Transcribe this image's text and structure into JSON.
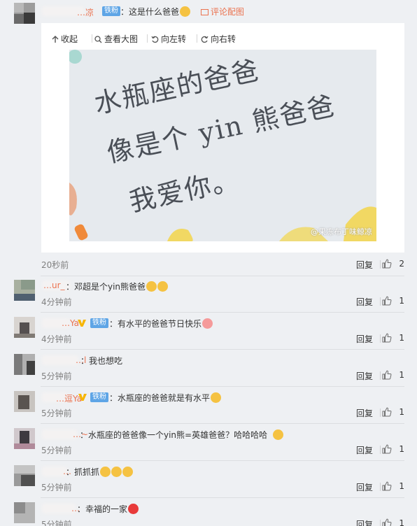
{
  "top_comment": {
    "name": "…凉",
    "fans_badge": "铁粉",
    "text": "：这是什么爸爸",
    "comment_image_label": "评论配图"
  },
  "viewer": {
    "collapse_label": "收起",
    "view_large_label": "查看大图",
    "rotate_left_label": "向左转",
    "rotate_right_label": "向右转",
    "photo": {
      "handwriting_line1": "水瓶座的爸爸",
      "handwriting_line2": "像是个 yin 熊爸爸",
      "handwriting_line3": "我爱你。",
      "watermark": "@果冻布丁味鲸凉"
    }
  },
  "top_meta": {
    "time": "20秒前",
    "reply_label": "回复",
    "likes": "2"
  },
  "comments": [
    {
      "name": "…ur_",
      "text": "：邓超是个yin熊爸爸",
      "time": "4分钟前",
      "reply_label": "回复",
      "likes": "1",
      "emoji_colors": [
        "#f5c242",
        "#f5c242"
      ]
    },
    {
      "name": "…Ya",
      "fans_badge": "铁粉",
      "text": "：有水平的爸爸节日快乐",
      "time": "4分钟前",
      "reply_label": "回复",
      "likes": "1",
      "emoji_colors": [
        "#f59a9a"
      ]
    },
    {
      "name": "…l",
      "text": "：我也想吃",
      "time": "5分钟前",
      "reply_label": "回复",
      "likes": "1",
      "emoji_colors": []
    },
    {
      "name": "…逗Ya",
      "fans_badge": "铁粉",
      "text": "：水瓶座的爸爸就是有水平",
      "time": "5分钟前",
      "reply_label": "回复",
      "likes": "1",
      "emoji_colors": [
        "#f5c242"
      ]
    },
    {
      "name": "…~",
      "text": "：水瓶座的爸爸像一个yin熊=英雄爸爸？哈哈哈哈",
      "time": "5分钟前",
      "reply_label": "回复",
      "likes": "1",
      "emoji_colors": [
        "#f5c242"
      ]
    },
    {
      "name": "…",
      "text": "：抓抓抓",
      "time": "5分钟前",
      "reply_label": "回复",
      "likes": "1",
      "emoji_colors": [
        "#f5c242",
        "#f5c242",
        "#f5c242"
      ]
    },
    {
      "name": "…",
      "text": "：幸福的一家",
      "time": "5分钟前",
      "reply_label": "回复",
      "likes": "1",
      "emoji_colors": [
        "#e83a3a"
      ]
    }
  ],
  "colors": {
    "name": "#eb7350",
    "fans_badge": "#5ea5e6",
    "vip": "#f7b500"
  }
}
